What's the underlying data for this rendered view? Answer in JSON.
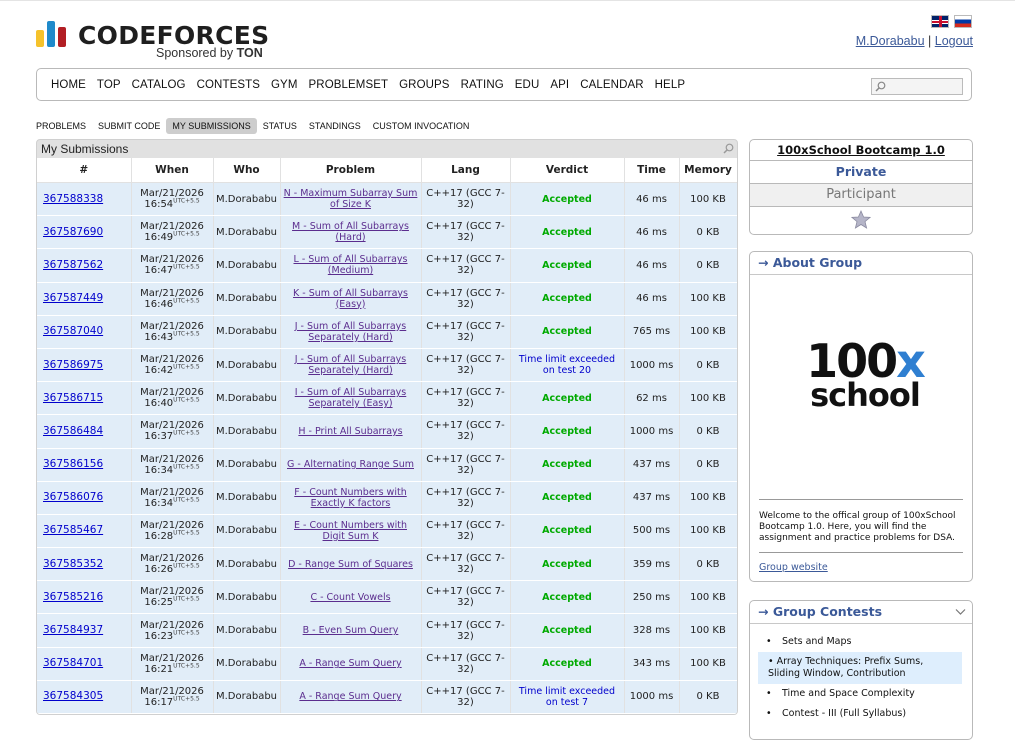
{
  "header": {
    "logo_main": "CODEFORCES",
    "logo_sub_prefix": "Sponsored by ",
    "logo_sub_brand": "TON",
    "username": "M.Dorababu",
    "separator": "|",
    "logout": "Logout"
  },
  "main_menu": [
    "HOME",
    "TOP",
    "CATALOG",
    "CONTESTS",
    "GYM",
    "PROBLEMSET",
    "GROUPS",
    "RATING",
    "EDU",
    "API",
    "CALENDAR",
    "HELP"
  ],
  "second_menu": [
    "PROBLEMS",
    "SUBMIT CODE",
    "MY SUBMISSIONS",
    "STATUS",
    "STANDINGS",
    "CUSTOM INVOCATION"
  ],
  "second_menu_active": "MY SUBMISSIONS",
  "submissions": {
    "title": "My Submissions",
    "columns": [
      "#",
      "When",
      "Who",
      "Problem",
      "Lang",
      "Verdict",
      "Time",
      "Memory"
    ],
    "rows": [
      {
        "id": "367588338",
        "date": "Mar/21/2026",
        "time": "16:54",
        "tz": "UTC+5.5",
        "who": "M.Dorababu",
        "problem": "N - Maximum Subarray Sum of Size K",
        "lang": "C++17 (GCC 7-32)",
        "verdict": "Accepted",
        "verdict_type": "ok",
        "run": "46 ms",
        "mem": "100 KB"
      },
      {
        "id": "367587690",
        "date": "Mar/21/2026",
        "time": "16:49",
        "tz": "UTC+5.5",
        "who": "M.Dorababu",
        "problem": "M - Sum of All Subarrays (Hard)",
        "lang": "C++17 (GCC 7-32)",
        "verdict": "Accepted",
        "verdict_type": "ok",
        "run": "46 ms",
        "mem": "0 KB"
      },
      {
        "id": "367587562",
        "date": "Mar/21/2026",
        "time": "16:47",
        "tz": "UTC+5.5",
        "who": "M.Dorababu",
        "problem": "L - Sum of All Subarrays (Medium)",
        "lang": "C++17 (GCC 7-32)",
        "verdict": "Accepted",
        "verdict_type": "ok",
        "run": "46 ms",
        "mem": "0 KB"
      },
      {
        "id": "367587449",
        "date": "Mar/21/2026",
        "time": "16:46",
        "tz": "UTC+5.5",
        "who": "M.Dorababu",
        "problem": "K - Sum of All Subarrays (Easy)",
        "lang": "C++17 (GCC 7-32)",
        "verdict": "Accepted",
        "verdict_type": "ok",
        "run": "46 ms",
        "mem": "100 KB"
      },
      {
        "id": "367587040",
        "date": "Mar/21/2026",
        "time": "16:43",
        "tz": "UTC+5.5",
        "who": "M.Dorababu",
        "problem": "J - Sum of All Subarrays Separately (Hard)",
        "lang": "C++17 (GCC 7-32)",
        "verdict": "Accepted",
        "verdict_type": "ok",
        "run": "765 ms",
        "mem": "100 KB"
      },
      {
        "id": "367586975",
        "date": "Mar/21/2026",
        "time": "16:42",
        "tz": "UTC+5.5",
        "who": "M.Dorababu",
        "problem": "J - Sum of All Subarrays Separately (Hard)",
        "lang": "C++17 (GCC 7-32)",
        "verdict": "Time limit exceeded on test 20",
        "verdict_type": "tle",
        "run": "1000 ms",
        "mem": "0 KB"
      },
      {
        "id": "367586715",
        "date": "Mar/21/2026",
        "time": "16:40",
        "tz": "UTC+5.5",
        "who": "M.Dorababu",
        "problem": "I - Sum of All Subarrays Separately (Easy)",
        "lang": "C++17 (GCC 7-32)",
        "verdict": "Accepted",
        "verdict_type": "ok",
        "run": "62 ms",
        "mem": "100 KB"
      },
      {
        "id": "367586484",
        "date": "Mar/21/2026",
        "time": "16:37",
        "tz": "UTC+5.5",
        "who": "M.Dorababu",
        "problem": "H - Print All Subarrays",
        "lang": "C++17 (GCC 7-32)",
        "verdict": "Accepted",
        "verdict_type": "ok",
        "run": "1000 ms",
        "mem": "0 KB"
      },
      {
        "id": "367586156",
        "date": "Mar/21/2026",
        "time": "16:34",
        "tz": "UTC+5.5",
        "who": "M.Dorababu",
        "problem": "G - Alternating Range Sum",
        "lang": "C++17 (GCC 7-32)",
        "verdict": "Accepted",
        "verdict_type": "ok",
        "run": "437 ms",
        "mem": "0 KB"
      },
      {
        "id": "367586076",
        "date": "Mar/21/2026",
        "time": "16:34",
        "tz": "UTC+5.5",
        "who": "M.Dorababu",
        "problem": "F - Count Numbers with Exactly K factors",
        "lang": "C++17 (GCC 7-32)",
        "verdict": "Accepted",
        "verdict_type": "ok",
        "run": "437 ms",
        "mem": "100 KB"
      },
      {
        "id": "367585467",
        "date": "Mar/21/2026",
        "time": "16:28",
        "tz": "UTC+5.5",
        "who": "M.Dorababu",
        "problem": "E - Count Numbers with Digit Sum K",
        "lang": "C++17 (GCC 7-32)",
        "verdict": "Accepted",
        "verdict_type": "ok",
        "run": "500 ms",
        "mem": "100 KB"
      },
      {
        "id": "367585352",
        "date": "Mar/21/2026",
        "time": "16:26",
        "tz": "UTC+5.5",
        "who": "M.Dorababu",
        "problem": "D - Range Sum of Squares",
        "lang": "C++17 (GCC 7-32)",
        "verdict": "Accepted",
        "verdict_type": "ok",
        "run": "359 ms",
        "mem": "0 KB"
      },
      {
        "id": "367585216",
        "date": "Mar/21/2026",
        "time": "16:25",
        "tz": "UTC+5.5",
        "who": "M.Dorababu",
        "problem": "C - Count Vowels",
        "lang": "C++17 (GCC 7-32)",
        "verdict": "Accepted",
        "verdict_type": "ok",
        "run": "250 ms",
        "mem": "100 KB"
      },
      {
        "id": "367584937",
        "date": "Mar/21/2026",
        "time": "16:23",
        "tz": "UTC+5.5",
        "who": "M.Dorababu",
        "problem": "B - Even Sum Query",
        "lang": "C++17 (GCC 7-32)",
        "verdict": "Accepted",
        "verdict_type": "ok",
        "run": "328 ms",
        "mem": "100 KB"
      },
      {
        "id": "367584701",
        "date": "Mar/21/2026",
        "time": "16:21",
        "tz": "UTC+5.5",
        "who": "M.Dorababu",
        "problem": "A - Range Sum Query",
        "lang": "C++17 (GCC 7-32)",
        "verdict": "Accepted",
        "verdict_type": "ok",
        "run": "343 ms",
        "mem": "100 KB"
      },
      {
        "id": "367584305",
        "date": "Mar/21/2026",
        "time": "16:17",
        "tz": "UTC+5.5",
        "who": "M.Dorababu",
        "problem": "A - Range Sum Query",
        "lang": "C++17 (GCC 7-32)",
        "verdict": "Time limit exceeded on test 7",
        "verdict_type": "tle",
        "run": "1000 ms",
        "mem": "0 KB"
      }
    ]
  },
  "sidebar": {
    "group_title": "100xSchool Bootcamp 1.0",
    "visibility": "Private",
    "role": "Participant",
    "about_title": "→ About Group",
    "logo_line1_a": "100",
    "logo_line1_b": "x",
    "logo_line2": "school",
    "description": "Welcome to the offical group of 100xSchool Bootcamp 1.0. Here, you will find the assignment and practice problems for DSA.",
    "group_website": "Group website",
    "contests_title": "→ Group Contests",
    "contests": [
      "Sets and Maps",
      "Array Techniques: Prefix Sums, Sliding Window, Contribution",
      "Time and Space Complexity",
      "Contest - III (Full Syllabus)"
    ],
    "contests_highlighted_index": 1
  },
  "colors": {
    "accepted": "#00aa00",
    "tle": "#0000cc",
    "row_bg": "#e1edf8",
    "sidebar_title": "#3b5998",
    "logo_bar_yellow": "#f5c22b",
    "logo_bar_blue": "#1f8acb",
    "logo_bar_red": "#b21e24"
  }
}
